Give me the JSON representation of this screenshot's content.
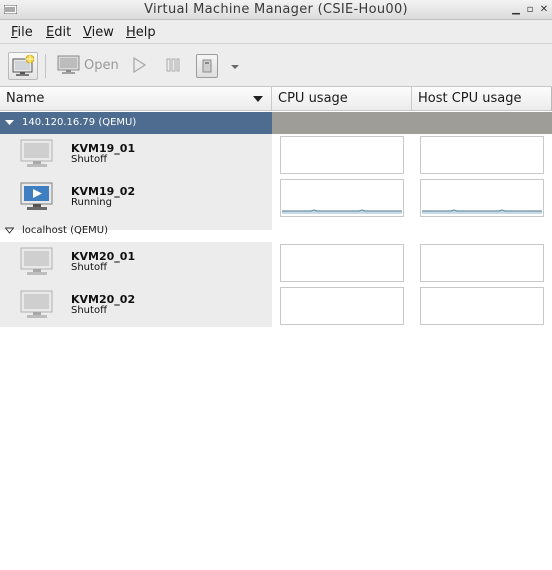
{
  "window": {
    "title": "Virtual Machine Manager (CSIE-Hou00)"
  },
  "menubar": {
    "items": [
      {
        "label": "File",
        "mnemonic": "F",
        "rest": "ile"
      },
      {
        "label": "Edit",
        "mnemonic": "E",
        "rest": "dit"
      },
      {
        "label": "View",
        "mnemonic": "V",
        "rest": "iew"
      },
      {
        "label": "Help",
        "mnemonic": "H",
        "rest": "elp"
      }
    ]
  },
  "toolbar": {
    "new_icon": "new-vm-icon",
    "open_label": "Open",
    "run_icon": "play-icon",
    "pause_icon": "pause-icon",
    "shutdown_icon": "shutdown-icon",
    "dropdown_icon": "chevron-down-icon"
  },
  "columns": {
    "name": "Name",
    "cpu": "CPU usage",
    "host_cpu": "Host CPU usage"
  },
  "connections": [
    {
      "label": "140.120.16.79 (QEMU)",
      "selected": true,
      "vms": [
        {
          "name": "KVM19_01",
          "status": "Shutoff",
          "running": false
        },
        {
          "name": "KVM19_02",
          "status": "Running",
          "running": true
        }
      ]
    },
    {
      "label": "localhost (QEMU)",
      "selected": false,
      "vms": [
        {
          "name": "KVM20_01",
          "status": "Shutoff",
          "running": false
        },
        {
          "name": "KVM20_02",
          "status": "Shutoff",
          "running": false
        }
      ]
    }
  ],
  "colors": {
    "selection": "#4d6c8f",
    "selection_rest": "#9e9d98",
    "graph_line": "#6f94a8",
    "graph_fill": "#c7dbe6"
  }
}
